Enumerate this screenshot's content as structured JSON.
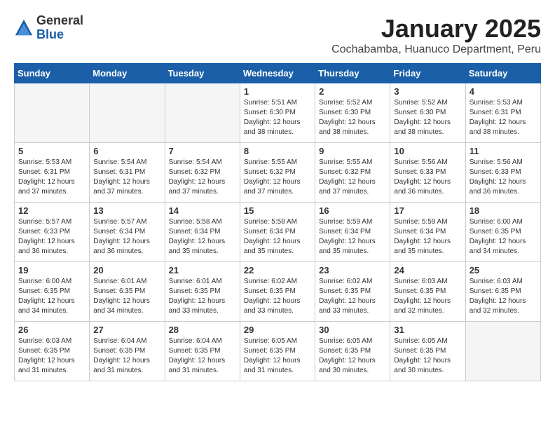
{
  "header": {
    "logo_general": "General",
    "logo_blue": "Blue",
    "calendar_title": "January 2025",
    "calendar_subtitle": "Cochabamba, Huanuco Department, Peru"
  },
  "weekdays": [
    "Sunday",
    "Monday",
    "Tuesday",
    "Wednesday",
    "Thursday",
    "Friday",
    "Saturday"
  ],
  "weeks": [
    [
      {
        "day": "",
        "empty": true
      },
      {
        "day": "",
        "empty": true
      },
      {
        "day": "",
        "empty": true
      },
      {
        "day": "1",
        "info": "Sunrise: 5:51 AM\nSunset: 6:30 PM\nDaylight: 12 hours\nand 38 minutes."
      },
      {
        "day": "2",
        "info": "Sunrise: 5:52 AM\nSunset: 6:30 PM\nDaylight: 12 hours\nand 38 minutes."
      },
      {
        "day": "3",
        "info": "Sunrise: 5:52 AM\nSunset: 6:30 PM\nDaylight: 12 hours\nand 38 minutes."
      },
      {
        "day": "4",
        "info": "Sunrise: 5:53 AM\nSunset: 6:31 PM\nDaylight: 12 hours\nand 38 minutes."
      }
    ],
    [
      {
        "day": "5",
        "info": "Sunrise: 5:53 AM\nSunset: 6:31 PM\nDaylight: 12 hours\nand 37 minutes."
      },
      {
        "day": "6",
        "info": "Sunrise: 5:54 AM\nSunset: 6:31 PM\nDaylight: 12 hours\nand 37 minutes."
      },
      {
        "day": "7",
        "info": "Sunrise: 5:54 AM\nSunset: 6:32 PM\nDaylight: 12 hours\nand 37 minutes."
      },
      {
        "day": "8",
        "info": "Sunrise: 5:55 AM\nSunset: 6:32 PM\nDaylight: 12 hours\nand 37 minutes."
      },
      {
        "day": "9",
        "info": "Sunrise: 5:55 AM\nSunset: 6:32 PM\nDaylight: 12 hours\nand 37 minutes."
      },
      {
        "day": "10",
        "info": "Sunrise: 5:56 AM\nSunset: 6:33 PM\nDaylight: 12 hours\nand 36 minutes."
      },
      {
        "day": "11",
        "info": "Sunrise: 5:56 AM\nSunset: 6:33 PM\nDaylight: 12 hours\nand 36 minutes."
      }
    ],
    [
      {
        "day": "12",
        "info": "Sunrise: 5:57 AM\nSunset: 6:33 PM\nDaylight: 12 hours\nand 36 minutes."
      },
      {
        "day": "13",
        "info": "Sunrise: 5:57 AM\nSunset: 6:34 PM\nDaylight: 12 hours\nand 36 minutes."
      },
      {
        "day": "14",
        "info": "Sunrise: 5:58 AM\nSunset: 6:34 PM\nDaylight: 12 hours\nand 35 minutes."
      },
      {
        "day": "15",
        "info": "Sunrise: 5:58 AM\nSunset: 6:34 PM\nDaylight: 12 hours\nand 35 minutes."
      },
      {
        "day": "16",
        "info": "Sunrise: 5:59 AM\nSunset: 6:34 PM\nDaylight: 12 hours\nand 35 minutes."
      },
      {
        "day": "17",
        "info": "Sunrise: 5:59 AM\nSunset: 6:34 PM\nDaylight: 12 hours\nand 35 minutes."
      },
      {
        "day": "18",
        "info": "Sunrise: 6:00 AM\nSunset: 6:35 PM\nDaylight: 12 hours\nand 34 minutes."
      }
    ],
    [
      {
        "day": "19",
        "info": "Sunrise: 6:00 AM\nSunset: 6:35 PM\nDaylight: 12 hours\nand 34 minutes."
      },
      {
        "day": "20",
        "info": "Sunrise: 6:01 AM\nSunset: 6:35 PM\nDaylight: 12 hours\nand 34 minutes."
      },
      {
        "day": "21",
        "info": "Sunrise: 6:01 AM\nSunset: 6:35 PM\nDaylight: 12 hours\nand 33 minutes."
      },
      {
        "day": "22",
        "info": "Sunrise: 6:02 AM\nSunset: 6:35 PM\nDaylight: 12 hours\nand 33 minutes."
      },
      {
        "day": "23",
        "info": "Sunrise: 6:02 AM\nSunset: 6:35 PM\nDaylight: 12 hours\nand 33 minutes."
      },
      {
        "day": "24",
        "info": "Sunrise: 6:03 AM\nSunset: 6:35 PM\nDaylight: 12 hours\nand 32 minutes."
      },
      {
        "day": "25",
        "info": "Sunrise: 6:03 AM\nSunset: 6:35 PM\nDaylight: 12 hours\nand 32 minutes."
      }
    ],
    [
      {
        "day": "26",
        "info": "Sunrise: 6:03 AM\nSunset: 6:35 PM\nDaylight: 12 hours\nand 31 minutes."
      },
      {
        "day": "27",
        "info": "Sunrise: 6:04 AM\nSunset: 6:35 PM\nDaylight: 12 hours\nand 31 minutes."
      },
      {
        "day": "28",
        "info": "Sunrise: 6:04 AM\nSunset: 6:35 PM\nDaylight: 12 hours\nand 31 minutes."
      },
      {
        "day": "29",
        "info": "Sunrise: 6:05 AM\nSunset: 6:35 PM\nDaylight: 12 hours\nand 31 minutes."
      },
      {
        "day": "30",
        "info": "Sunrise: 6:05 AM\nSunset: 6:35 PM\nDaylight: 12 hours\nand 30 minutes."
      },
      {
        "day": "31",
        "info": "Sunrise: 6:05 AM\nSunset: 6:35 PM\nDaylight: 12 hours\nand 30 minutes."
      },
      {
        "day": "",
        "empty": true
      }
    ]
  ]
}
